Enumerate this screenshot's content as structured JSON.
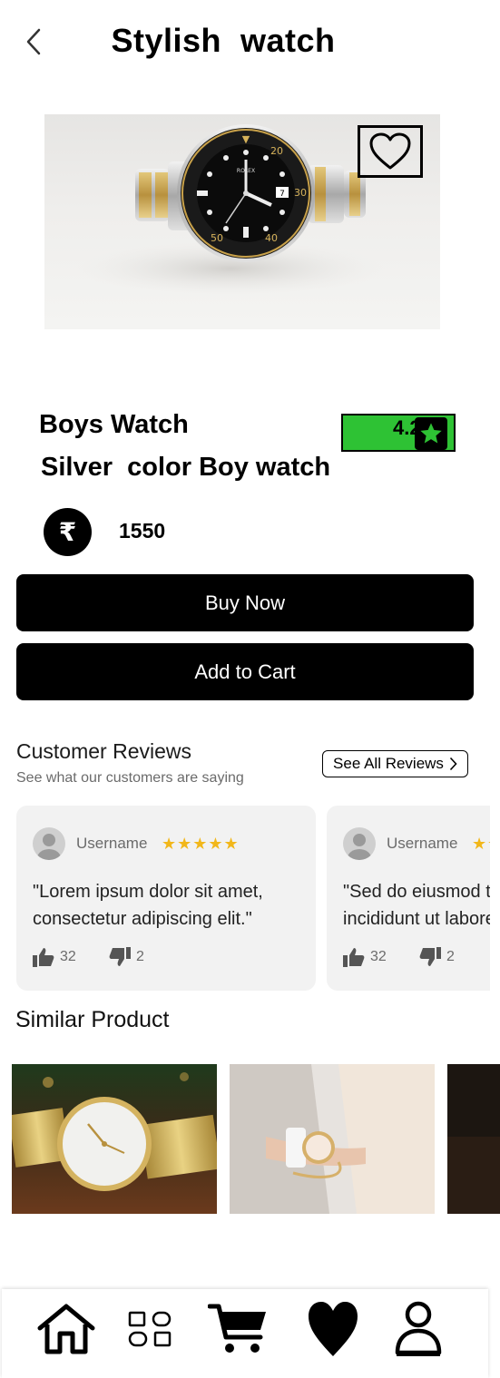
{
  "header": {
    "title": "Stylish  watch"
  },
  "product": {
    "name": "Boys Watch",
    "subtitle": "Silver  color Boy watch",
    "rating": "4.2",
    "currency_symbol": "₹",
    "price": "1550",
    "rating_color": "#2ec234"
  },
  "actions": {
    "buy_now": "Buy Now",
    "add_to_cart": "Add to Cart"
  },
  "reviews": {
    "title": "Customer Reviews",
    "subtitle": "See what our customers are saying",
    "see_all": "See All Reviews",
    "items": [
      {
        "username": "Username",
        "stars": "★★★★★",
        "text_line1": "\"Lorem ipsum dolor sit amet,",
        "text_line2": "consectetur adipiscing elit.\"",
        "likes": "32",
        "dislikes": "2"
      },
      {
        "username": "Username",
        "stars": "★★★★★",
        "text_line1": "\"Sed do eiusmod tempor",
        "text_line2": "incididunt ut labore.\"",
        "likes": "32",
        "dislikes": "2"
      }
    ]
  },
  "similar": {
    "title": "Similar Product"
  },
  "nav": {
    "items": [
      "home-icon",
      "categories-icon",
      "cart-icon",
      "heart-icon",
      "profile-icon"
    ]
  }
}
